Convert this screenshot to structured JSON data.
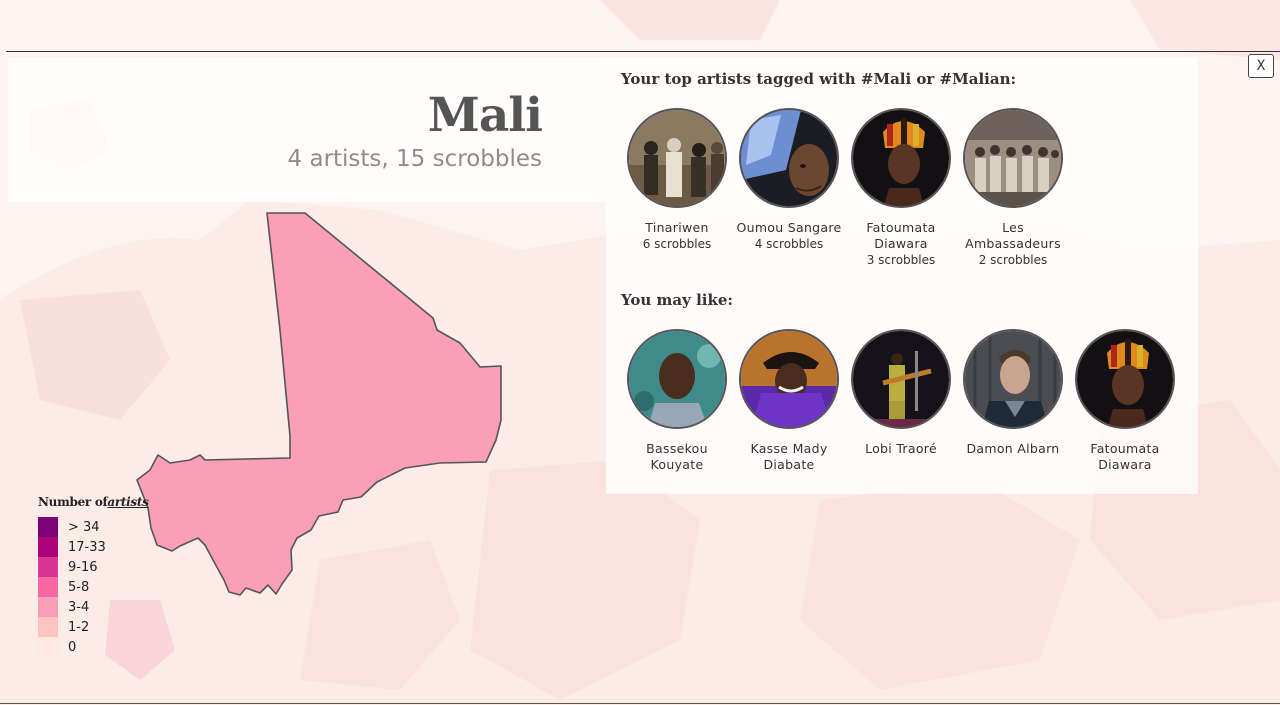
{
  "close_button": {
    "label": "X"
  },
  "country": {
    "name": "Mali",
    "subtitle": "4 artists, 15 scrobbles"
  },
  "top_artists": {
    "title": "Your top artists tagged with #Mali or #Malian:",
    "items": [
      {
        "name": "Tinariwen",
        "scrobbles": "6 scrobbles",
        "icon": "band-photo"
      },
      {
        "name": "Oumou Sangare",
        "scrobbles": "4 scrobbles",
        "icon": "portrait-photo"
      },
      {
        "name": "Fatoumata Diawara",
        "scrobbles": "3 scrobbles",
        "icon": "portrait-photo"
      },
      {
        "name": "Les Ambassadeurs",
        "scrobbles": "2 scrobbles",
        "icon": "band-photo"
      }
    ]
  },
  "recommendations": {
    "title": "You may like:",
    "items": [
      {
        "name": "Bassekou Kouyate",
        "icon": "portrait-photo"
      },
      {
        "name": "Kasse Mady Diabate",
        "icon": "portrait-photo"
      },
      {
        "name": "Lobi Traoré",
        "icon": "stage-photo"
      },
      {
        "name": "Damon Albarn",
        "icon": "portrait-photo"
      },
      {
        "name": "Fatoumata Diawara",
        "icon": "portrait-photo"
      }
    ]
  },
  "legend": {
    "title_prefix": "Number of",
    "title_link": "artists",
    "items": [
      {
        "label": "> 34",
        "color": "#7a0177"
      },
      {
        "label": "17-33",
        "color": "#ae017e"
      },
      {
        "label": "9-16",
        "color": "#dd3497"
      },
      {
        "label": "5-8",
        "color": "#f768a1"
      },
      {
        "label": "3-4",
        "color": "#fa9fb5"
      },
      {
        "label": "1-2",
        "color": "#fcc5c0"
      },
      {
        "label": "0",
        "color": "#fde8e3"
      }
    ]
  },
  "colors": {
    "mali_fill": "#fa9fb5",
    "background": "#fdf2ef"
  }
}
